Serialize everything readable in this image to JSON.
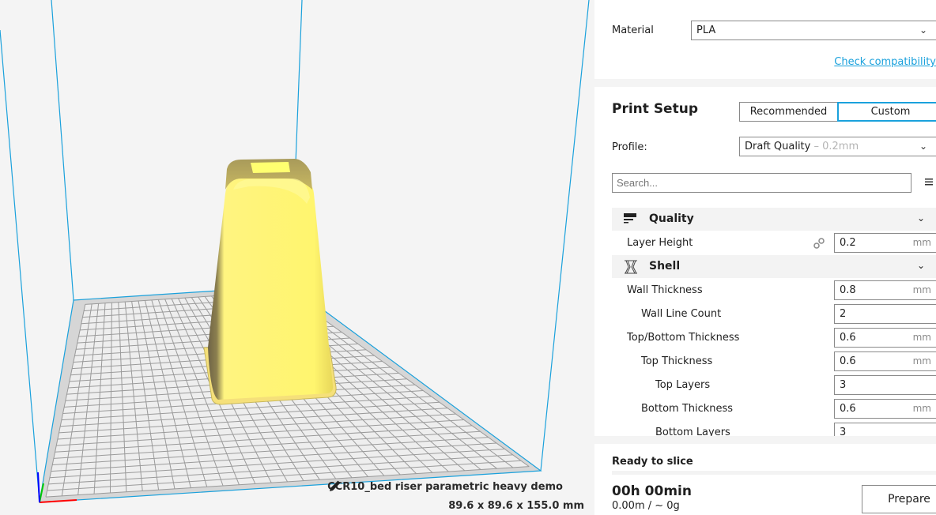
{
  "viewport": {
    "object_name": "CCR10_bed riser parametric heavy demo",
    "object_dimensions": "89.6 x 89.6 x 155.0 mm",
    "icons": {
      "edit": "pencil-icon"
    },
    "colors": {
      "build_volume_edge": "#1aa1dc",
      "model": "#fff56e",
      "model_shadow": "#7a6d47",
      "bed": "#d8d8d8",
      "axis_x": "#ff0000",
      "axis_y": "#00cc00",
      "axis_z": "#0000ff"
    }
  },
  "material": {
    "label": "Material",
    "value": "PLA",
    "check_compatibility": "Check compatibility"
  },
  "print_setup": {
    "title": "Print Setup",
    "modes": [
      {
        "label": "Recommended",
        "active": false
      },
      {
        "label": "Custom",
        "active": true
      }
    ],
    "profile_label": "Profile:",
    "profile_value": "Draft Quality",
    "profile_suffix": "– 0.2mm",
    "search_placeholder": "Search...",
    "categories": [
      {
        "name": "Quality",
        "icon": "quality-icon",
        "settings": [
          {
            "label": "Layer Height",
            "value": "0.2",
            "unit": "mm",
            "indent": 0,
            "linked": true
          }
        ]
      },
      {
        "name": "Shell",
        "icon": "shell-icon",
        "settings": [
          {
            "label": "Wall Thickness",
            "value": "0.8",
            "unit": "mm",
            "indent": 0
          },
          {
            "label": "Wall Line Count",
            "value": "2",
            "unit": "",
            "indent": 1
          },
          {
            "label": "Top/Bottom Thickness",
            "value": "0.6",
            "unit": "mm",
            "indent": 0
          },
          {
            "label": "Top Thickness",
            "value": "0.6",
            "unit": "mm",
            "indent": 1
          },
          {
            "label": "Top Layers",
            "value": "3",
            "unit": "",
            "indent": 2
          },
          {
            "label": "Bottom Thickness",
            "value": "0.6",
            "unit": "mm",
            "indent": 1
          },
          {
            "label": "Bottom Layers",
            "value": "3",
            "unit": "",
            "indent": 2
          }
        ]
      }
    ]
  },
  "slice": {
    "status": "Ready to slice",
    "time": "00h 00min",
    "usage": "0.00m / ~ 0g",
    "prepare_label": "Prepare"
  },
  "accent_color": "#1aa1dc"
}
